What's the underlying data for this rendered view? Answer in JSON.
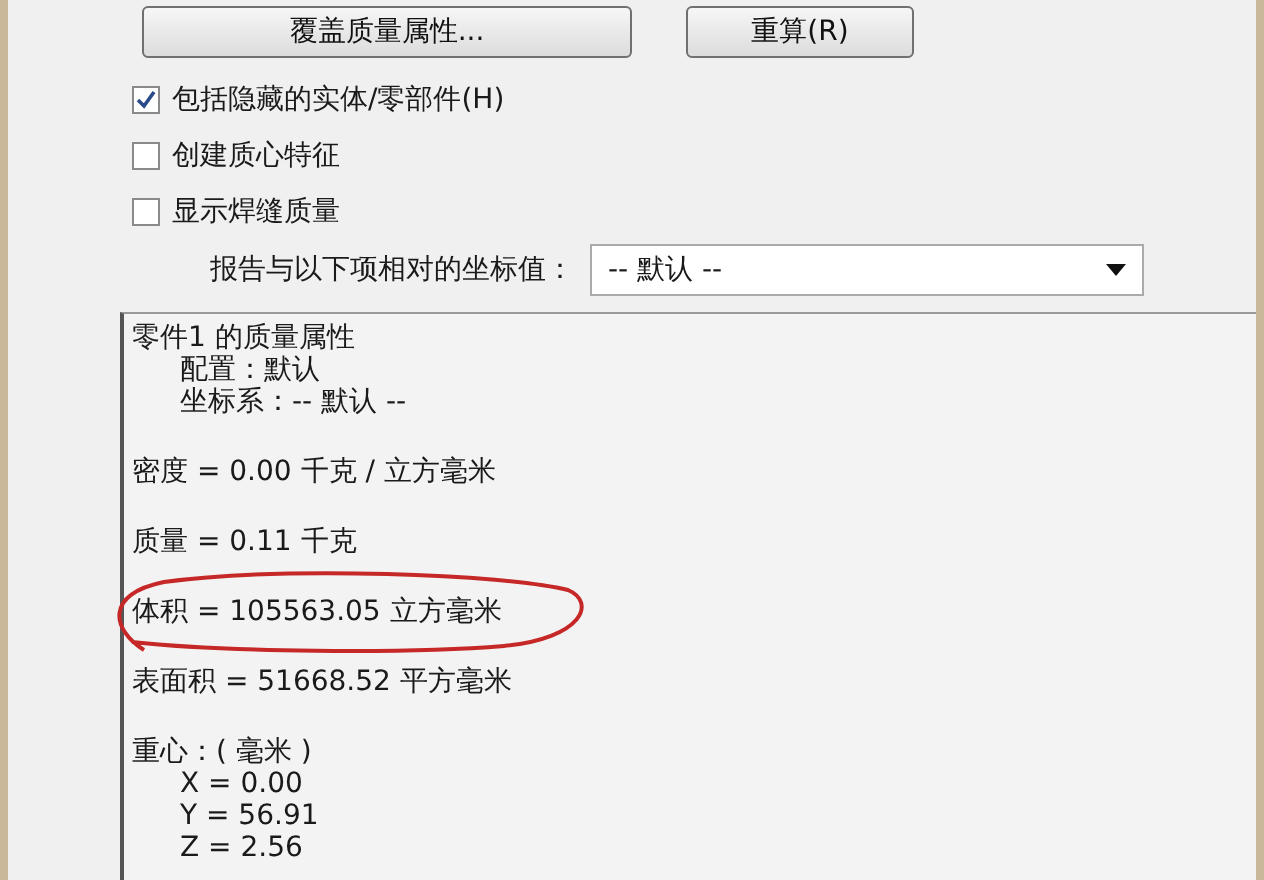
{
  "buttons": [
    {
      "label": "覆盖质量属性..."
    },
    {
      "label": "重算(R)"
    }
  ],
  "options": [
    {
      "label": "包括隐藏的实体/零部件(H)",
      "checked": true
    },
    {
      "label": "创建质心特征",
      "checked": false
    },
    {
      "label": "显示焊缝质量",
      "checked": false
    }
  ],
  "coordinate_select": {
    "label": "报告与以下项相对的坐标值：",
    "value": "-- 默认 --"
  },
  "report": [
    {
      "text": "零件1 的质量属性",
      "children": [
        {
          "text": "配置：默认"
        },
        {
          "text": "坐标系：-- 默认 --"
        }
      ]
    },
    {
      "text": "密度 = 0.00 千克 / 立方毫米"
    },
    {
      "text": "质量 = 0.11 千克"
    },
    {
      "text": "体积 = 105563.05 立方毫米",
      "circled": true
    },
    {
      "text": "表面积 = 51668.52  平方毫米"
    },
    {
      "text": "重心：( 毫米 )",
      "children": [
        {
          "text": "X = 0.00"
        },
        {
          "text": "Y = 56.91"
        },
        {
          "text": "Z = 2.56"
        }
      ]
    }
  ]
}
